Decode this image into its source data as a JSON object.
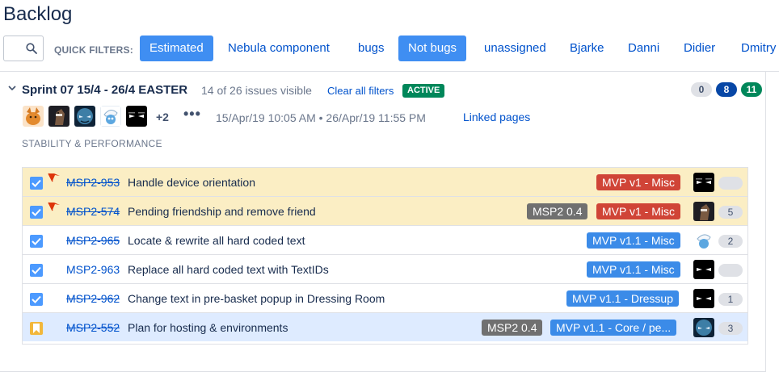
{
  "page": {
    "title": "Backlog"
  },
  "quick_filters": {
    "label": "QUICK FILTERS:",
    "items": [
      {
        "label": "Estimated",
        "active": true
      },
      {
        "label": "Nebula component",
        "active": false
      },
      {
        "label": "bugs",
        "active": false
      },
      {
        "label": "Not bugs",
        "active": true
      },
      {
        "label": "unassigned",
        "active": false
      },
      {
        "label": "Bjarke",
        "active": false
      },
      {
        "label": "Danni",
        "active": false
      },
      {
        "label": "Didier",
        "active": false
      },
      {
        "label": "Dmitry",
        "active": false
      }
    ]
  },
  "sprint": {
    "name": "Sprint 07 15/4 - 26/4 EASTER",
    "visible_count": "14 of 26 issues visible",
    "clear_filters": "Clear all filters",
    "state": "ACTIVE",
    "status_counts": {
      "todo": "0",
      "in_progress": "8",
      "done": "11"
    },
    "extra_assignees": "+2",
    "more": "•••",
    "dates": "15/Apr/19 10:05 AM  •  26/Apr/19 11:55 PM",
    "linked_pages": "Linked pages",
    "goal": "STABILITY & PERFORMANCE",
    "assignee_avatars": [
      "avatar-orange-cat",
      "avatar-horse",
      "avatar-blue-creature",
      "avatar-smurf",
      "avatar-dark-eyes"
    ]
  },
  "issues": [
    {
      "key": "MSP2-953",
      "summary": "Handle device orientation",
      "done": true,
      "flagged": true,
      "type": "task",
      "version": "",
      "epic": "MVP v1 - Misc",
      "epic_color": "red",
      "assignee": "avatar-dark-eyes",
      "estimate": ""
    },
    {
      "key": "MSP2-574",
      "summary": "Pending friendship and remove friend",
      "done": true,
      "flagged": true,
      "type": "task",
      "version": "MSP2 0.4",
      "epic": "MVP v1 - Misc",
      "epic_color": "red",
      "assignee": "avatar-horse",
      "estimate": "5"
    },
    {
      "key": "MSP2-965",
      "summary": "Locate & rewrite all hard coded text",
      "done": true,
      "flagged": false,
      "type": "task",
      "version": "",
      "epic": "MVP v1.1 - Misc",
      "epic_color": "blue",
      "assignee": "avatar-smurf",
      "estimate": "2"
    },
    {
      "key": "MSP2-963",
      "summary": "Replace all hard coded text with TextIDs",
      "done": false,
      "flagged": false,
      "type": "task",
      "version": "",
      "epic": "MVP v1.1 - Misc",
      "epic_color": "blue",
      "assignee": "avatar-dark-eyes",
      "estimate": ""
    },
    {
      "key": "MSP2-962",
      "summary": "Change text in pre-basket popup in Dressing Room",
      "done": true,
      "flagged": false,
      "type": "task",
      "version": "",
      "epic": "MVP v1.1 - Dressup",
      "epic_color": "blue",
      "assignee": "avatar-dark-eyes",
      "estimate": "1"
    },
    {
      "key": "MSP2-552",
      "summary": "Plan for hosting & environments",
      "done": true,
      "flagged": false,
      "type": "story",
      "version": "MSP2 0.4",
      "epic": "MVP v1.1 - Core / pe...",
      "epic_color": "blue",
      "assignee": "avatar-blue-creature",
      "estimate": "3",
      "selected": true
    }
  ],
  "icons": {
    "search": "search-icon",
    "chevron": "chevron-down-icon",
    "flag": "flag-icon",
    "checkbox": "checkbox-icon",
    "story": "story-icon"
  },
  "colors": {
    "filter_active": "#3f8ef2",
    "flagged_row": "#fbeec4",
    "selected_row": "#deebff",
    "epic_red": "#d04437",
    "epic_blue": "#3b8be8",
    "version_gray": "#707070",
    "active_green": "#00875a",
    "in_progress_blue": "#0747a6"
  }
}
